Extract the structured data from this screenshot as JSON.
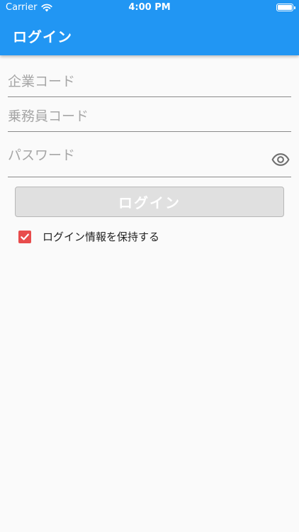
{
  "status_bar": {
    "carrier": "Carrier",
    "time": "4:00 PM"
  },
  "header": {
    "title": "ログイン",
    "color": "#2196f3"
  },
  "form": {
    "company_code": {
      "value": "",
      "placeholder": "企業コード"
    },
    "staff_code": {
      "value": "",
      "placeholder": "乗務員コード"
    },
    "password": {
      "value": "",
      "placeholder": "パスワード",
      "visibility_icon": "eye-icon"
    },
    "login_button_label": "ログイン",
    "remember": {
      "label": "ログイン情報を保持する",
      "checked": true,
      "color": "#e84c4c"
    }
  }
}
